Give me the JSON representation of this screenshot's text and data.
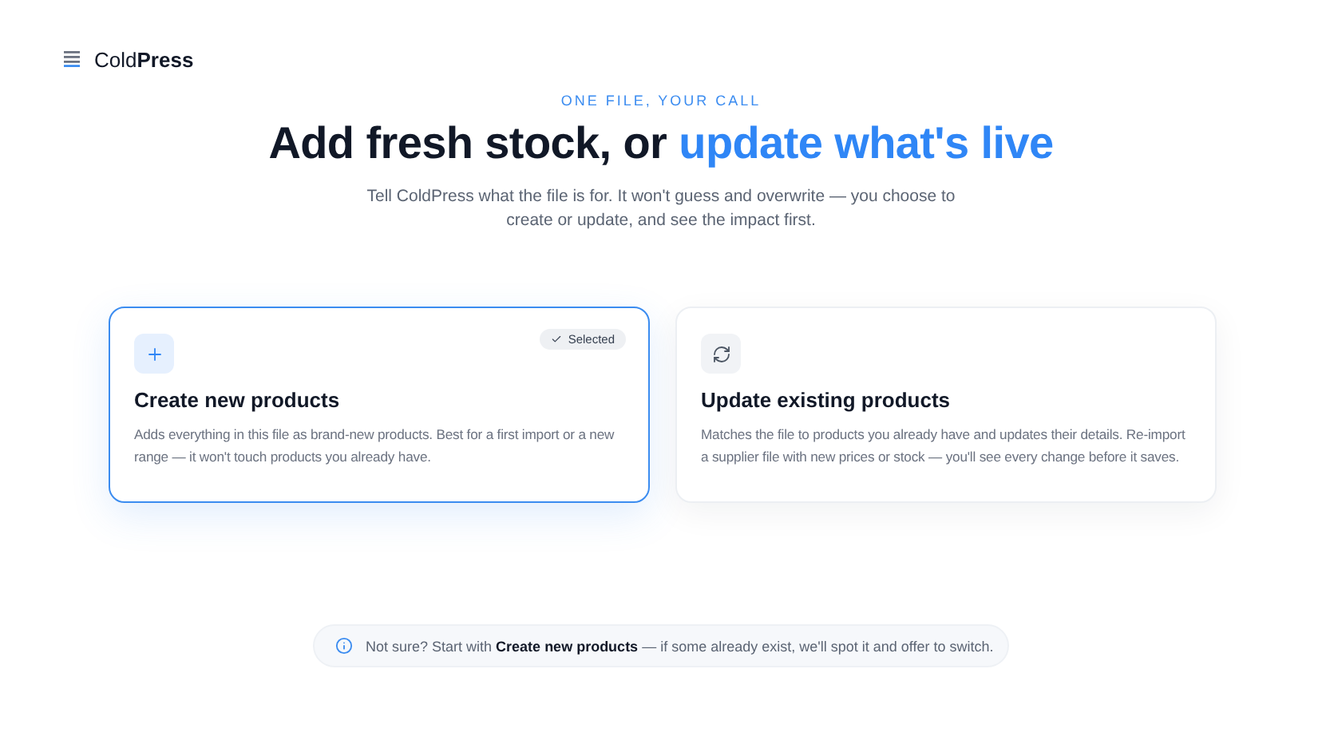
{
  "brand": {
    "name": "Cold**Press**"
  },
  "eyebrow": "ONE FILE, YOUR CALL",
  "heading": {
    "lead": "Add fresh stock, or ",
    "highlight": "update what's live"
  },
  "subtitle": "Tell ColdPress what the file is for. It won't guess and overwrite — you choose to create or update, and see the impact first.",
  "selected_badge": "Selected",
  "options": [
    {
      "kind": "plus",
      "title": "Create new products",
      "description": "Adds everything in this file as brand-new products. Best for a first import or a new range — it won't touch products you already have.",
      "selected": true
    },
    {
      "kind": "refresh",
      "title": "Update existing products",
      "description": "Matches the file to products you already have and updates their details. Re-import a supplier file with new prices or stock — you'll see every change before it saves.",
      "selected": false
    }
  ],
  "hint": "Not sure? Start with **Create new products** — if some already exist, we'll spot it and offer to switch."
}
